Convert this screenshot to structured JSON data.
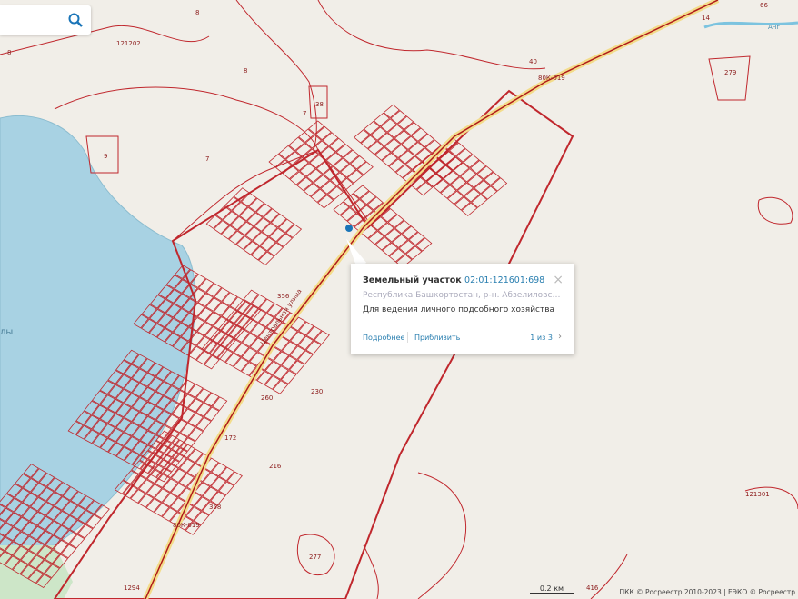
{
  "search": {
    "placeholder": "",
    "icon": "search-icon"
  },
  "popup": {
    "type_label": "Земельный участок",
    "cadastral_number": "02:01:121601:698",
    "address": "Республика Башкортостан, р-н. Абзелиловский, с/с. ...",
    "usage": "Для ведения личного подсобного хозяйства",
    "details_link": "Подробнее",
    "zoom_link": "Приблизить",
    "pager": "1 из 3",
    "close": "×",
    "next": "›"
  },
  "scale": "0.2 км",
  "attribution": "ПКК © Росреестр 2010-2023 | ЕЭКО © Росреестр",
  "map_labels": [
    {
      "text": "8"
    },
    {
      "text": "121202"
    },
    {
      "text": "8"
    },
    {
      "text": "8"
    },
    {
      "text": "7"
    },
    {
      "text": "38"
    },
    {
      "text": "9"
    },
    {
      "text": "7"
    },
    {
      "text": "40"
    },
    {
      "text": "66"
    },
    {
      "text": "14"
    },
    {
      "text": "279"
    },
    {
      "text": "121301"
    },
    {
      "text": "356"
    },
    {
      "text": "358"
    },
    {
      "text": "416"
    },
    {
      "text": "277"
    },
    {
      "text": "1294"
    },
    {
      "text": "260"
    },
    {
      "text": "230"
    },
    {
      "text": "216"
    },
    {
      "text": "172"
    }
  ],
  "road_labels": {
    "street": "Центральная улица",
    "highway": "80К-019",
    "river": "Анг"
  },
  "lake_label": "лы",
  "colors": {
    "parcel": "#c0272d",
    "lake": "#a8d2e3",
    "land": "#f1eee8",
    "road": "#f3dc8a",
    "link": "#2a7fb0"
  }
}
